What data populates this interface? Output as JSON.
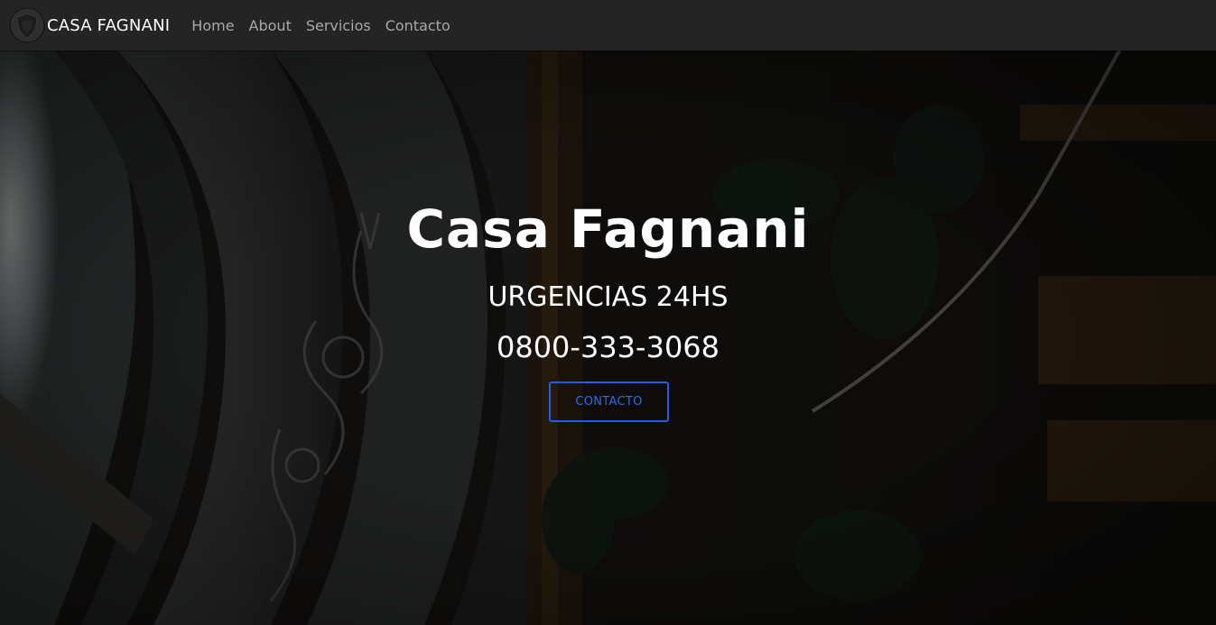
{
  "navbar": {
    "logo_icon": "shield-logo-icon",
    "brand": "CASA FAGNANI",
    "links": [
      {
        "label": "Home"
      },
      {
        "label": "About"
      },
      {
        "label": "Servicios"
      },
      {
        "label": "Contacto"
      }
    ]
  },
  "hero": {
    "title": "Casa Fagnani",
    "subtitle": "URGENCIAS 24HS",
    "phone": "0800-333-3068",
    "button_label": "CONTACTO"
  },
  "colors": {
    "navbar_bg": "#242424",
    "button_accent": "#1f5fe0",
    "hero_text": "#ffffff"
  }
}
